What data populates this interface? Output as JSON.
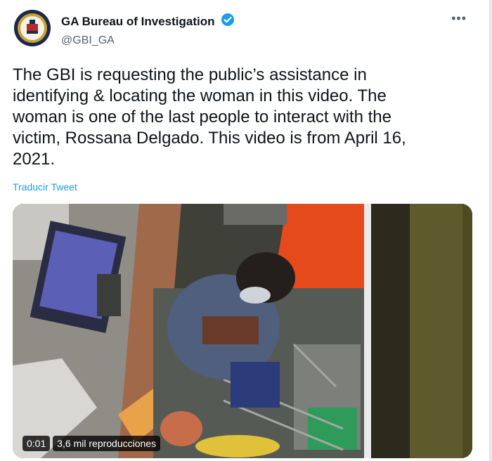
{
  "account": {
    "display_name": "GA Bureau of Investigation",
    "handle": "@GBI_GA",
    "avatar_icon": "gbi-seal-icon",
    "verified_icon": "verified-badge-icon",
    "accent_color": "#1d9bf0"
  },
  "menu": {
    "more_label": "•••"
  },
  "tweet": {
    "text": "The GBI is requesting the public’s assistance in\nidentifying & locating the woman in this video.  The\nwoman is one of the last people to interact with the\nvictim, Rossana Delgado.  This video is from April 16,\n2021.",
    "translate_label": "Traducir Tweet"
  },
  "video": {
    "time": "0:01",
    "views": "3,6 mil reproducciones"
  }
}
